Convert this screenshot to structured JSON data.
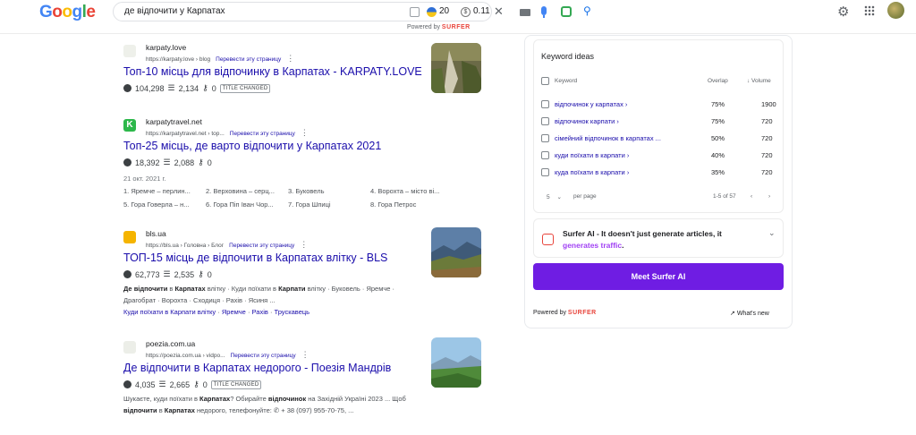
{
  "header": {
    "logo_letters": [
      {
        "ch": "G",
        "color": "#4285F4"
      },
      {
        "ch": "o",
        "color": "#EA4335"
      },
      {
        "ch": "o",
        "color": "#FBBC05"
      },
      {
        "ch": "g",
        "color": "#4285F4"
      },
      {
        "ch": "l",
        "color": "#34A853"
      },
      {
        "ch": "e",
        "color": "#EA4335"
      }
    ],
    "search_query": "де відпочити у Карпатах",
    "badge_count": "20",
    "badge_value": "0.11",
    "clear_glyph": "✕",
    "search_glyph": "⚲",
    "powered_by": "Powered by",
    "surfer": "SURFER",
    "gear_glyph": "⚙"
  },
  "results": [
    {
      "site": "karpaty.love",
      "url": "https://karpaty.love › blog",
      "translate": "Перевести эту страницу",
      "title": "Топ-10 місць для відпочинку в Карпатах - KARPATY.LOVE",
      "traffic": "104,298",
      "words": "2,134",
      "keywords": "0",
      "tag": "TITLE CHANGED",
      "favicon_color": "#e8eaed"
    },
    {
      "site": "karpatytravel.net",
      "url": "https://karpatytravel.net › top...",
      "translate": "Перевести эту страницу",
      "title": "Топ-25 місць, де варто відпочити у Карпатах 2021",
      "traffic": "18,392",
      "words": "2,088",
      "keywords": "0",
      "date": "21 окт. 2021 г.",
      "grid": [
        "1. Яремче – перлин...",
        "2. Верховина – серц...",
        "3. Буковель",
        "4. Ворохта – місто ві...",
        "5. Гора Говерла – н...",
        "6. Гора Піп Іван Чор...",
        "7. Гора Шпиці",
        "8. Гора Петрос"
      ],
      "favicon_color": "#2db84b"
    },
    {
      "site": "bls.ua",
      "url": "https://bls.ua › Головна › Блог",
      "translate": "Перевести эту страницу",
      "title": "ТОП-15 місць де відпочити в Карпатах влітку - BLS",
      "traffic": "62,773",
      "words": "2,535",
      "keywords": "0",
      "snippet_parts": [
        "Де відпочити",
        " в ",
        "Карпатах",
        " влітку · Куди поїхати в ",
        "Карпати",
        " влітку · Буковель · Яремче · Драгобрат · Ворохта · Сходиця · Рахів · Ясиня ..."
      ],
      "sublinks": [
        "Куди поїхати в Карпати влітку",
        "Яремче",
        "Рахів",
        "Трускавець"
      ],
      "favicon_color": "#f5b400"
    },
    {
      "site": "poezia.com.ua",
      "url": "https://poezia.com.ua › vidpo...",
      "translate": "Перевести эту страницу",
      "title": "Де відпочити в Карпатах недорого - Поезія Мандрів",
      "traffic": "4,035",
      "words": "2,665",
      "keywords": "0",
      "tag": "TITLE CHANGED",
      "snippet_parts": [
        "Шукаєте, куди поїхати в ",
        "Карпатах",
        "? Обирайте ",
        "відпочинок",
        " на Західній Україні 2023 ... Щоб ",
        "відпочити",
        " в ",
        "Карпатах",
        " недорого, телефонуйте: ✆ + 38 (097) 955-70-75, ..."
      ],
      "favicon_color": "#e8eaed"
    }
  ],
  "keyword_ideas": {
    "title": "Keyword ideas",
    "col_keyword": "Keyword",
    "col_overlap": "Overlap",
    "col_volume": "↓ Volume",
    "rows": [
      {
        "keyword": "відпочинок у карпатах ›",
        "overlap": "75%",
        "volume": "1900"
      },
      {
        "keyword": "відпочинок карпати ›",
        "overlap": "75%",
        "volume": "720"
      },
      {
        "keyword": "сімейний відпочинок в карпатах ...",
        "overlap": "50%",
        "volume": "720"
      },
      {
        "keyword": "куди поїхати в карпати ›",
        "overlap": "40%",
        "volume": "720"
      },
      {
        "keyword": "куда поїхати в карпати ›",
        "overlap": "35%",
        "volume": "720"
      }
    ],
    "per_page_value": "5",
    "per_page_label": "per page",
    "range": "1-5 of 57"
  },
  "surfer_ai": {
    "line1": "Surfer AI - It doesn't just generate articles, it",
    "line2_grad": "generates traffic",
    "line2_end": ".",
    "button": "Meet Surfer AI",
    "powered_by": "Powered by",
    "surfer": "SURFER",
    "whats_new": "What's new"
  }
}
